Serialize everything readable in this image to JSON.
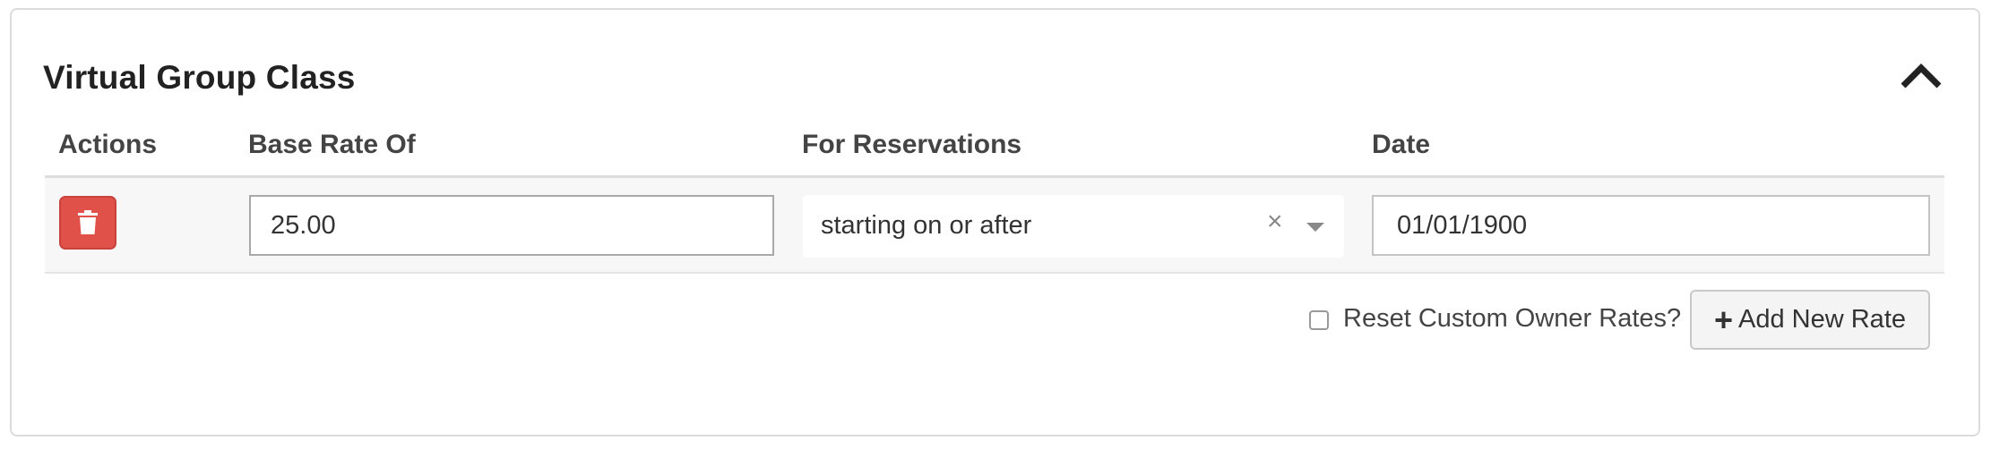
{
  "panel": {
    "title": "Virtual Group Class",
    "collapse_icon": "chevron-up-icon"
  },
  "columns": {
    "actions": "Actions",
    "base_rate": "Base Rate Of",
    "reservations": "For Reservations",
    "date": "Date"
  },
  "rate_row": {
    "delete_icon": "trash-icon",
    "base_rate_value": "25.00",
    "reservation_rule": "starting on or after",
    "clear_symbol": "×",
    "date_value": "01/01/1900"
  },
  "footer": {
    "reset_label": "Reset Custom Owner Rates?",
    "reset_checked": false,
    "add_plus": "+",
    "add_label": "Add New Rate"
  },
  "colors": {
    "delete_button": "#e05149",
    "border": "#dcdcdc",
    "row_background": "#f7f7f7"
  }
}
